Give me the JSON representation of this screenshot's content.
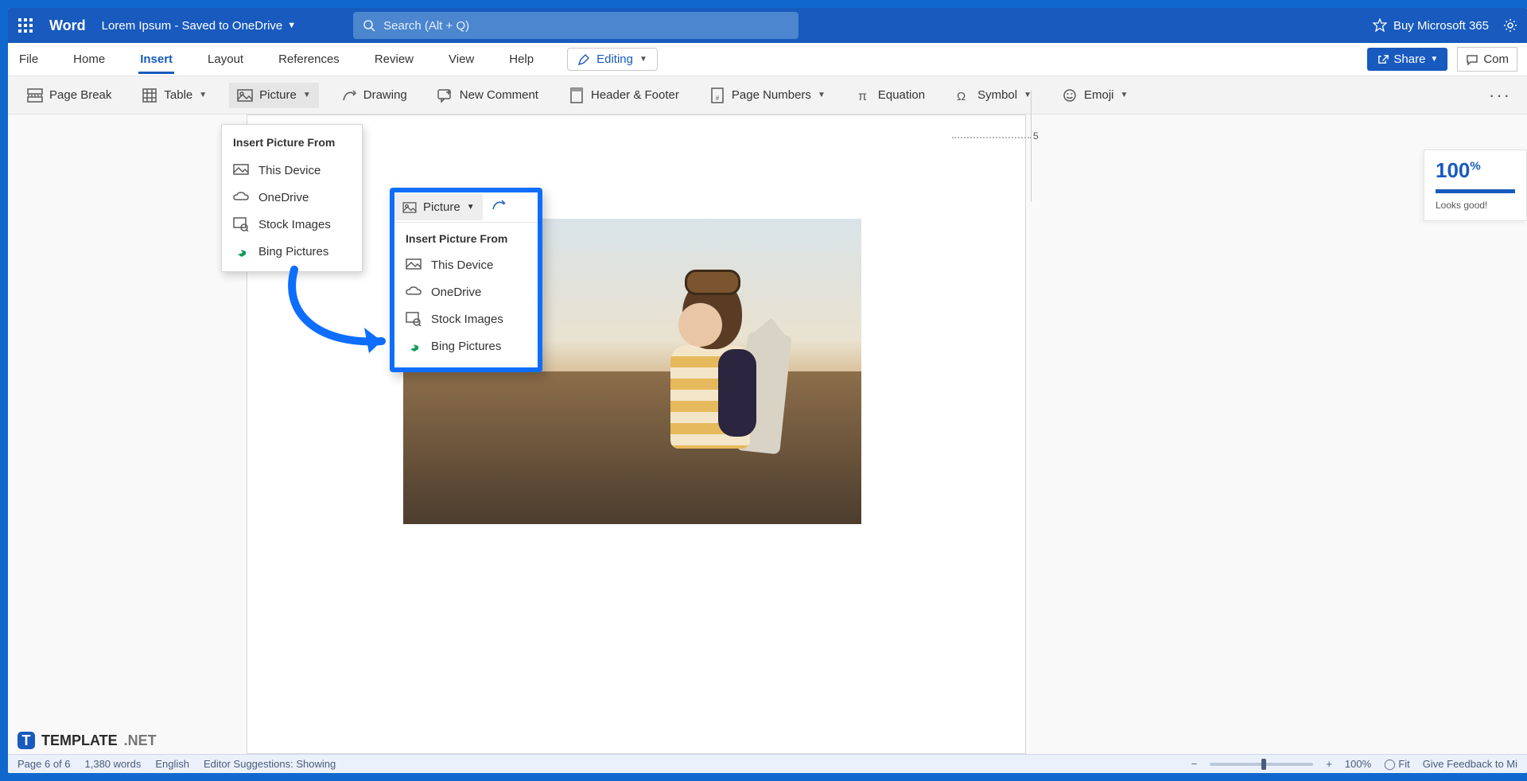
{
  "titlebar": {
    "app": "Word",
    "doc": "Lorem Ipsum  -  Saved to OneDrive",
    "search_placeholder": "Search (Alt + Q)",
    "buy": "Buy Microsoft 365"
  },
  "tabs": {
    "file": "File",
    "home": "Home",
    "insert": "Insert",
    "layout": "Layout",
    "references": "References",
    "review": "Review",
    "view": "View",
    "help": "Help",
    "editing": "Editing",
    "share": "Share",
    "comments": "Com"
  },
  "ribbon": {
    "pagebreak": "Page Break",
    "table": "Table",
    "picture": "Picture",
    "drawing": "Drawing",
    "newcomment": "New Comment",
    "headerfooter": "Header & Footer",
    "pagenumbers": "Page Numbers",
    "equation": "Equation",
    "symbol": "Symbol",
    "emoji": "Emoji"
  },
  "dropdown1": {
    "header": "Insert Picture From",
    "items": [
      "This Device",
      "OneDrive",
      "Stock Images",
      "Bing Pictures"
    ]
  },
  "popover": {
    "picture": "Picture",
    "header": "Insert Picture From",
    "items": [
      "This Device",
      "OneDrive",
      "Stock Images",
      "Bing Pictures"
    ]
  },
  "ruler": {
    "mark": "5"
  },
  "score": {
    "value": "100",
    "pct": "%",
    "msg": "Looks good!"
  },
  "status": {
    "page": "Page 6 of 6",
    "words": "1,380 words",
    "lang": "English",
    "suggestions": "Editor Suggestions: Showing",
    "zoom": "100%",
    "fit": "Fit",
    "feedback": "Give Feedback to Mi"
  },
  "badge": {
    "t": "T",
    "name": "TEMPLATE",
    "net": ".NET"
  }
}
